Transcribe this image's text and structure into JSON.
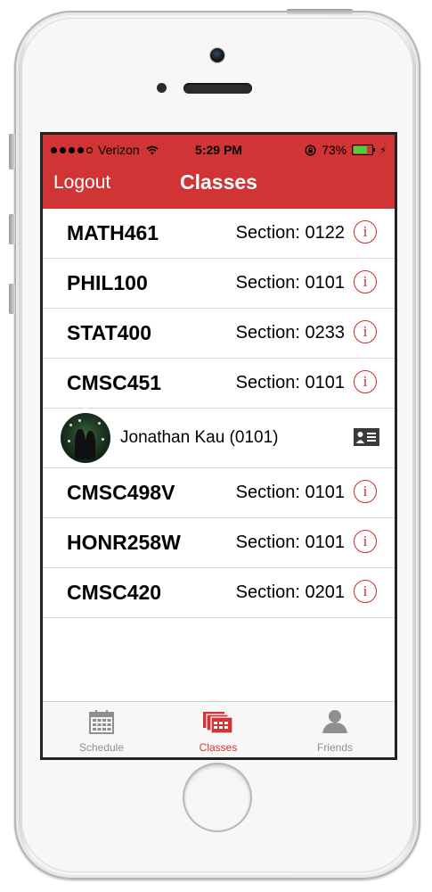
{
  "status_bar": {
    "carrier": "Verizon",
    "time": "5:29 PM",
    "battery": "73%",
    "battery_level": 0.73
  },
  "nav": {
    "left_button": "Logout",
    "title": "Classes"
  },
  "classes": [
    {
      "course": "MATH461",
      "section": "Section: 0122"
    },
    {
      "course": "PHIL100",
      "section": "Section: 0101"
    },
    {
      "course": "STAT400",
      "section": "Section: 0233"
    },
    {
      "course": "CMSC451",
      "section": "Section: 0101"
    },
    {
      "course": "CMSC498V",
      "section": "Section: 0101"
    },
    {
      "course": "HONR258W",
      "section": "Section: 0101"
    },
    {
      "course": "CMSC420",
      "section": "Section: 0201"
    }
  ],
  "friend": {
    "name": "Jonathan Kau (0101)"
  },
  "tabs": [
    {
      "label": "Schedule",
      "icon": "calendar-icon"
    },
    {
      "label": "Classes",
      "icon": "classes-icon"
    },
    {
      "label": "Friends",
      "icon": "person-icon"
    }
  ],
  "colors": {
    "accent": "#d03434",
    "tab_inactive": "#8f8f8f"
  }
}
